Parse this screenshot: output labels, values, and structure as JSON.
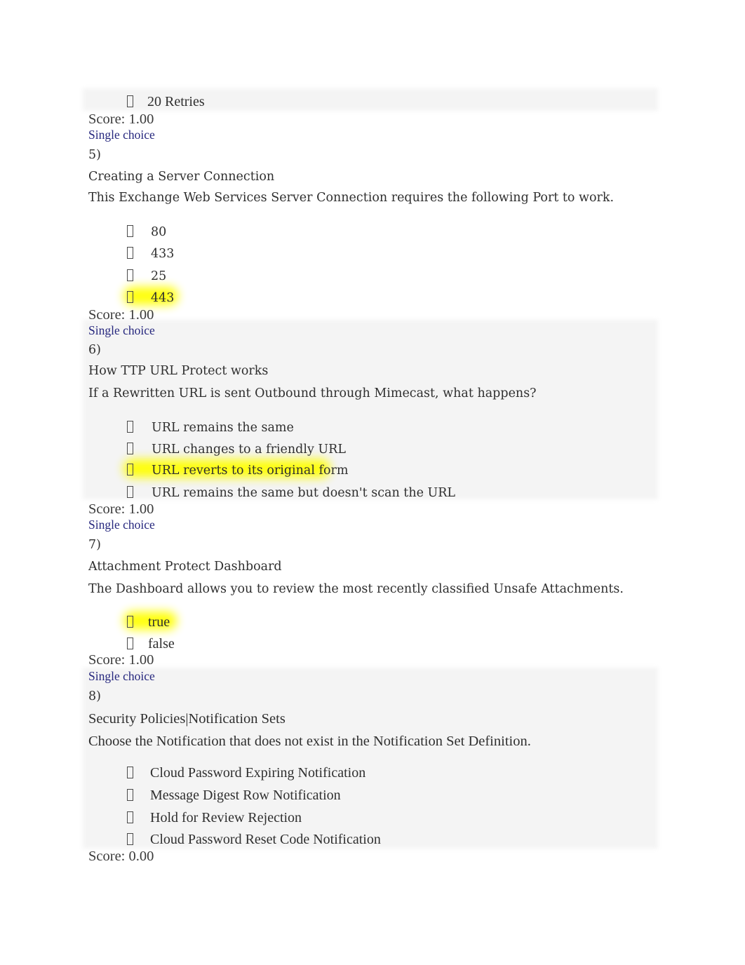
{
  "document": {
    "type": "quiz-results",
    "bullet_glyph": "missing-glyph-box",
    "highlight_color": "#ffff00",
    "question_type_color": "#26277e",
    "band_color": "#f4f4f4"
  },
  "partial_question": {
    "trailing_option": "20 Retries",
    "score_label": "Score: 1.00",
    "type_label": "Single choice"
  },
  "questions": [
    {
      "number": "5)",
      "title": "Creating a Server Connection",
      "prompt": "This Exchange Web Services Server Connection requires the following Port to work.",
      "options": [
        {
          "label": "80",
          "highlighted": false
        },
        {
          "label": "433",
          "highlighted": false
        },
        {
          "label": "25",
          "highlighted": false
        },
        {
          "label": "443",
          "highlighted": true
        }
      ],
      "score_label": "Score: 1.00",
      "type_label": "Single choice"
    },
    {
      "number": "6)",
      "title": "How TTP URL Protect works",
      "prompt": "If a Rewritten URL is sent Outbound through Mimecast, what happens?",
      "options": [
        {
          "label": "URL remains the same",
          "highlighted": false
        },
        {
          "label": "URL changes to a friendly URL",
          "highlighted": false
        },
        {
          "label": "URL reverts to its original form",
          "highlighted": true
        },
        {
          "label": "URL remains the same but doesn't scan the URL",
          "highlighted": false
        }
      ],
      "score_label": "Score: 1.00",
      "type_label": "Single choice"
    },
    {
      "number": "7)",
      "title": "Attachment Protect Dashboard",
      "prompt": "The Dashboard allows you to review the most recently classified Unsafe Attachments.",
      "options": [
        {
          "label": "true",
          "highlighted": true
        },
        {
          "label": "false",
          "highlighted": false
        }
      ],
      "score_label": "Score: 1.00",
      "type_label": "Single choice"
    },
    {
      "number": "8)",
      "title": "Security Policies|Notification Sets",
      "prompt": "Choose the Notification that does not exist in the Notification Set Definition.",
      "options": [
        {
          "label": "Cloud Password Expiring Notification",
          "highlighted": false
        },
        {
          "label": "Message Digest Row Notification",
          "highlighted": false
        },
        {
          "label": "Hold for Review Rejection",
          "highlighted": false
        },
        {
          "label": "Cloud Password Reset Code Notification",
          "highlighted": false
        }
      ],
      "score_label": "Score: 0.00",
      "type_label": "Single choice"
    }
  ]
}
